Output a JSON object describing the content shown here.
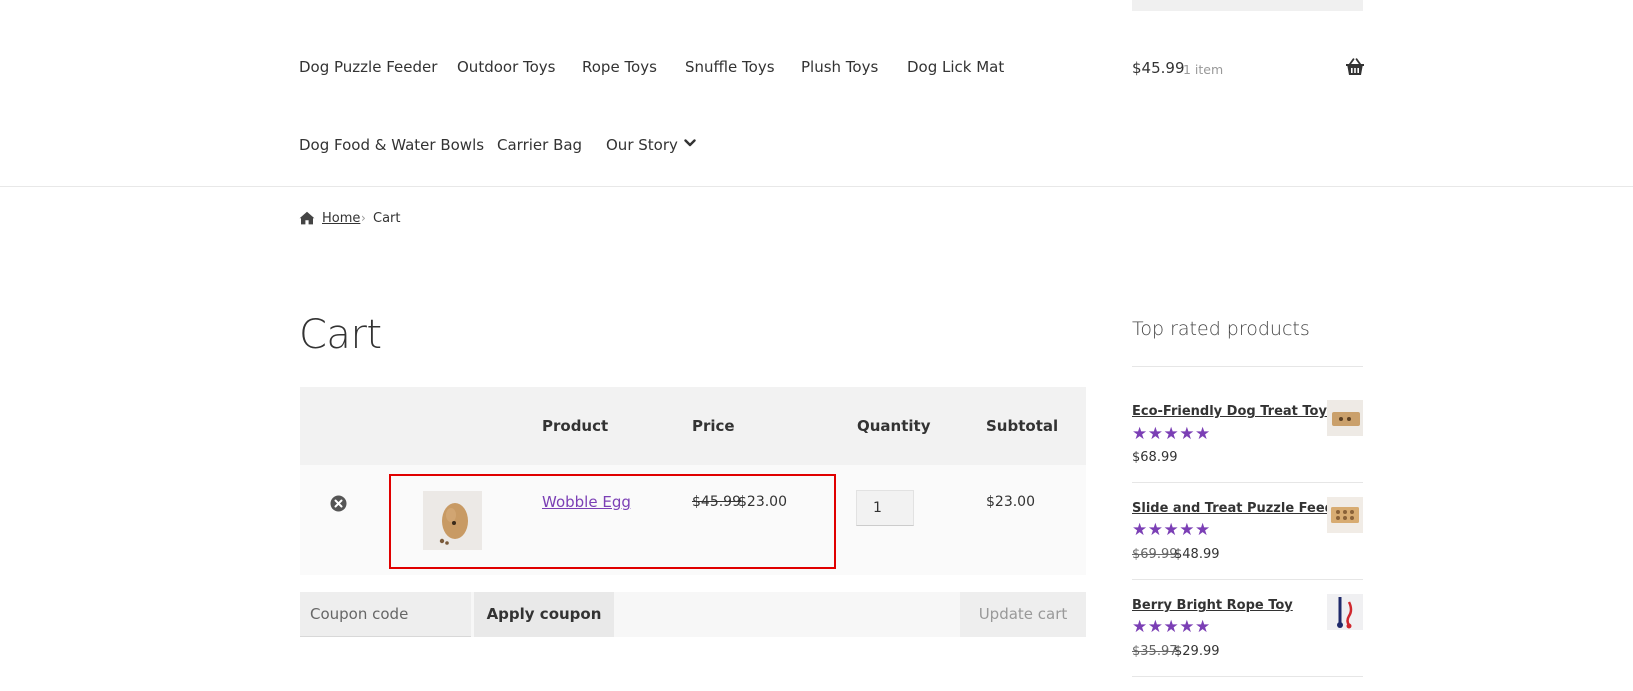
{
  "nav": {
    "items": [
      "Dog Puzzle Feeder",
      "Outdoor Toys",
      "Rope Toys",
      "Snuffle Toys",
      "Plush Toys",
      "Dog Lick Mat",
      "Dog Food & Water Bowls",
      "Carrier Bag",
      "Our Story"
    ]
  },
  "header_cart": {
    "amount": "$45.99",
    "count": "1 item",
    "icon": "basket-icon"
  },
  "breadcrumb": {
    "home": "Home",
    "separator": "›",
    "current": "Cart"
  },
  "page_title": "Cart",
  "cart_table": {
    "headers": {
      "product": "Product",
      "price": "Price",
      "quantity": "Quantity",
      "subtotal": "Subtotal"
    },
    "rows": [
      {
        "product": "Wobble Egg",
        "price_old": "$45.99",
        "price": "$23.00",
        "quantity": "1",
        "subtotal": "$23.00"
      }
    ]
  },
  "coupon": {
    "placeholder": "Coupon code",
    "apply_label": "Apply coupon",
    "update_label": "Update cart"
  },
  "sidebar": {
    "title": "Top rated products",
    "products": [
      {
        "name": "Eco-Friendly Dog Treat Toys",
        "rating": 5,
        "stars": "★★★★★",
        "price_old": "",
        "price": "$68.99"
      },
      {
        "name": "Slide and Treat Puzzle Feeder",
        "rating": 5,
        "stars": "★★★★★",
        "price_old": "$69.99",
        "price": "$48.99"
      },
      {
        "name": "Berry Bright Rope Toy",
        "rating": 5,
        "stars": "★★★★★",
        "price_old": "$35.97",
        "price": "$29.99"
      }
    ]
  },
  "colors": {
    "accent_purple": "#7b3fb5",
    "highlight_red": "#e00000"
  }
}
